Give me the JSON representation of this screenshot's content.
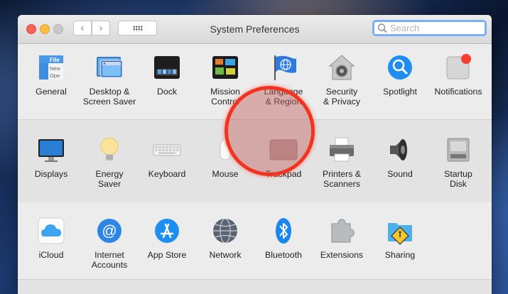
{
  "window": {
    "title": "System Preferences",
    "accent": "#7aaef7"
  },
  "search": {
    "placeholder": "Search",
    "value": ""
  },
  "sections": [
    [
      {
        "label": "General"
      },
      {
        "label": "Desktop &\nScreen Saver"
      },
      {
        "label": "Dock"
      },
      {
        "label": "Mission\nControl"
      },
      {
        "label": "Language\n& Region"
      },
      {
        "label": "Security\n& Privacy"
      },
      {
        "label": "Spotlight"
      },
      {
        "label": "Notifications"
      }
    ],
    [
      {
        "label": "Displays"
      },
      {
        "label": "Energy\nSaver"
      },
      {
        "label": "Keyboard"
      },
      {
        "label": "Mouse"
      },
      {
        "label": "Trackpad"
      },
      {
        "label": "Printers &\nScanners"
      },
      {
        "label": "Sound"
      },
      {
        "label": "Startup\nDisk"
      }
    ],
    [
      {
        "label": "iCloud"
      },
      {
        "label": "Internet\nAccounts"
      },
      {
        "label": "App Store"
      },
      {
        "label": "Network"
      },
      {
        "label": "Bluetooth"
      },
      {
        "label": "Extensions"
      },
      {
        "label": "Sharing"
      }
    ]
  ],
  "general_icon_text": "File\nNew\nOpe",
  "highlight_color": "#f2331f"
}
